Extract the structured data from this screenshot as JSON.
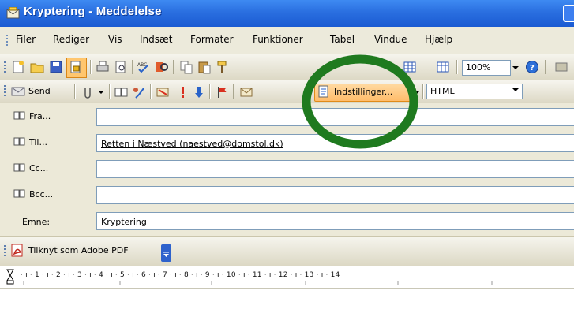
{
  "window": {
    "title": "Kryptering - Meddelelse"
  },
  "menu": {
    "items": [
      "Filer",
      "Rediger",
      "Vis",
      "Indsæt",
      "Formater",
      "Funktioner",
      "Tabel",
      "Vindue",
      "Hjælp"
    ]
  },
  "toolbar1": {
    "zoom": "100%"
  },
  "toolbar2": {
    "send_label": "Send",
    "options_label": "Indstillinger...",
    "format_value": "HTML"
  },
  "fields": {
    "from": {
      "label": "Fra...",
      "value": ""
    },
    "to": {
      "label": "Til...",
      "value": "Retten i Næstved (naestved@domstol.dk)"
    },
    "cc": {
      "label": "Cc...",
      "value": ""
    },
    "bcc": {
      "label": "Bcc...",
      "value": ""
    },
    "subject": {
      "label": "Emne:",
      "value": "Kryptering"
    }
  },
  "attach_bar": {
    "label": "Tilknyt som Adobe PDF"
  },
  "ruler": {
    "text": "· ı · 1 · ı · 2 · ı · 3 · ı · 4 · ı · 5 · ı · 6 · ı · 7 · ı · 8 · ı · 9 · ı · 10 · ı · 11 · ı · 12 · ı · 13 · ı · 14"
  },
  "colors": {
    "annotation": "#1f7a1f",
    "titlebar": "#2a6fe0",
    "highlight": "#ffbc6a"
  }
}
